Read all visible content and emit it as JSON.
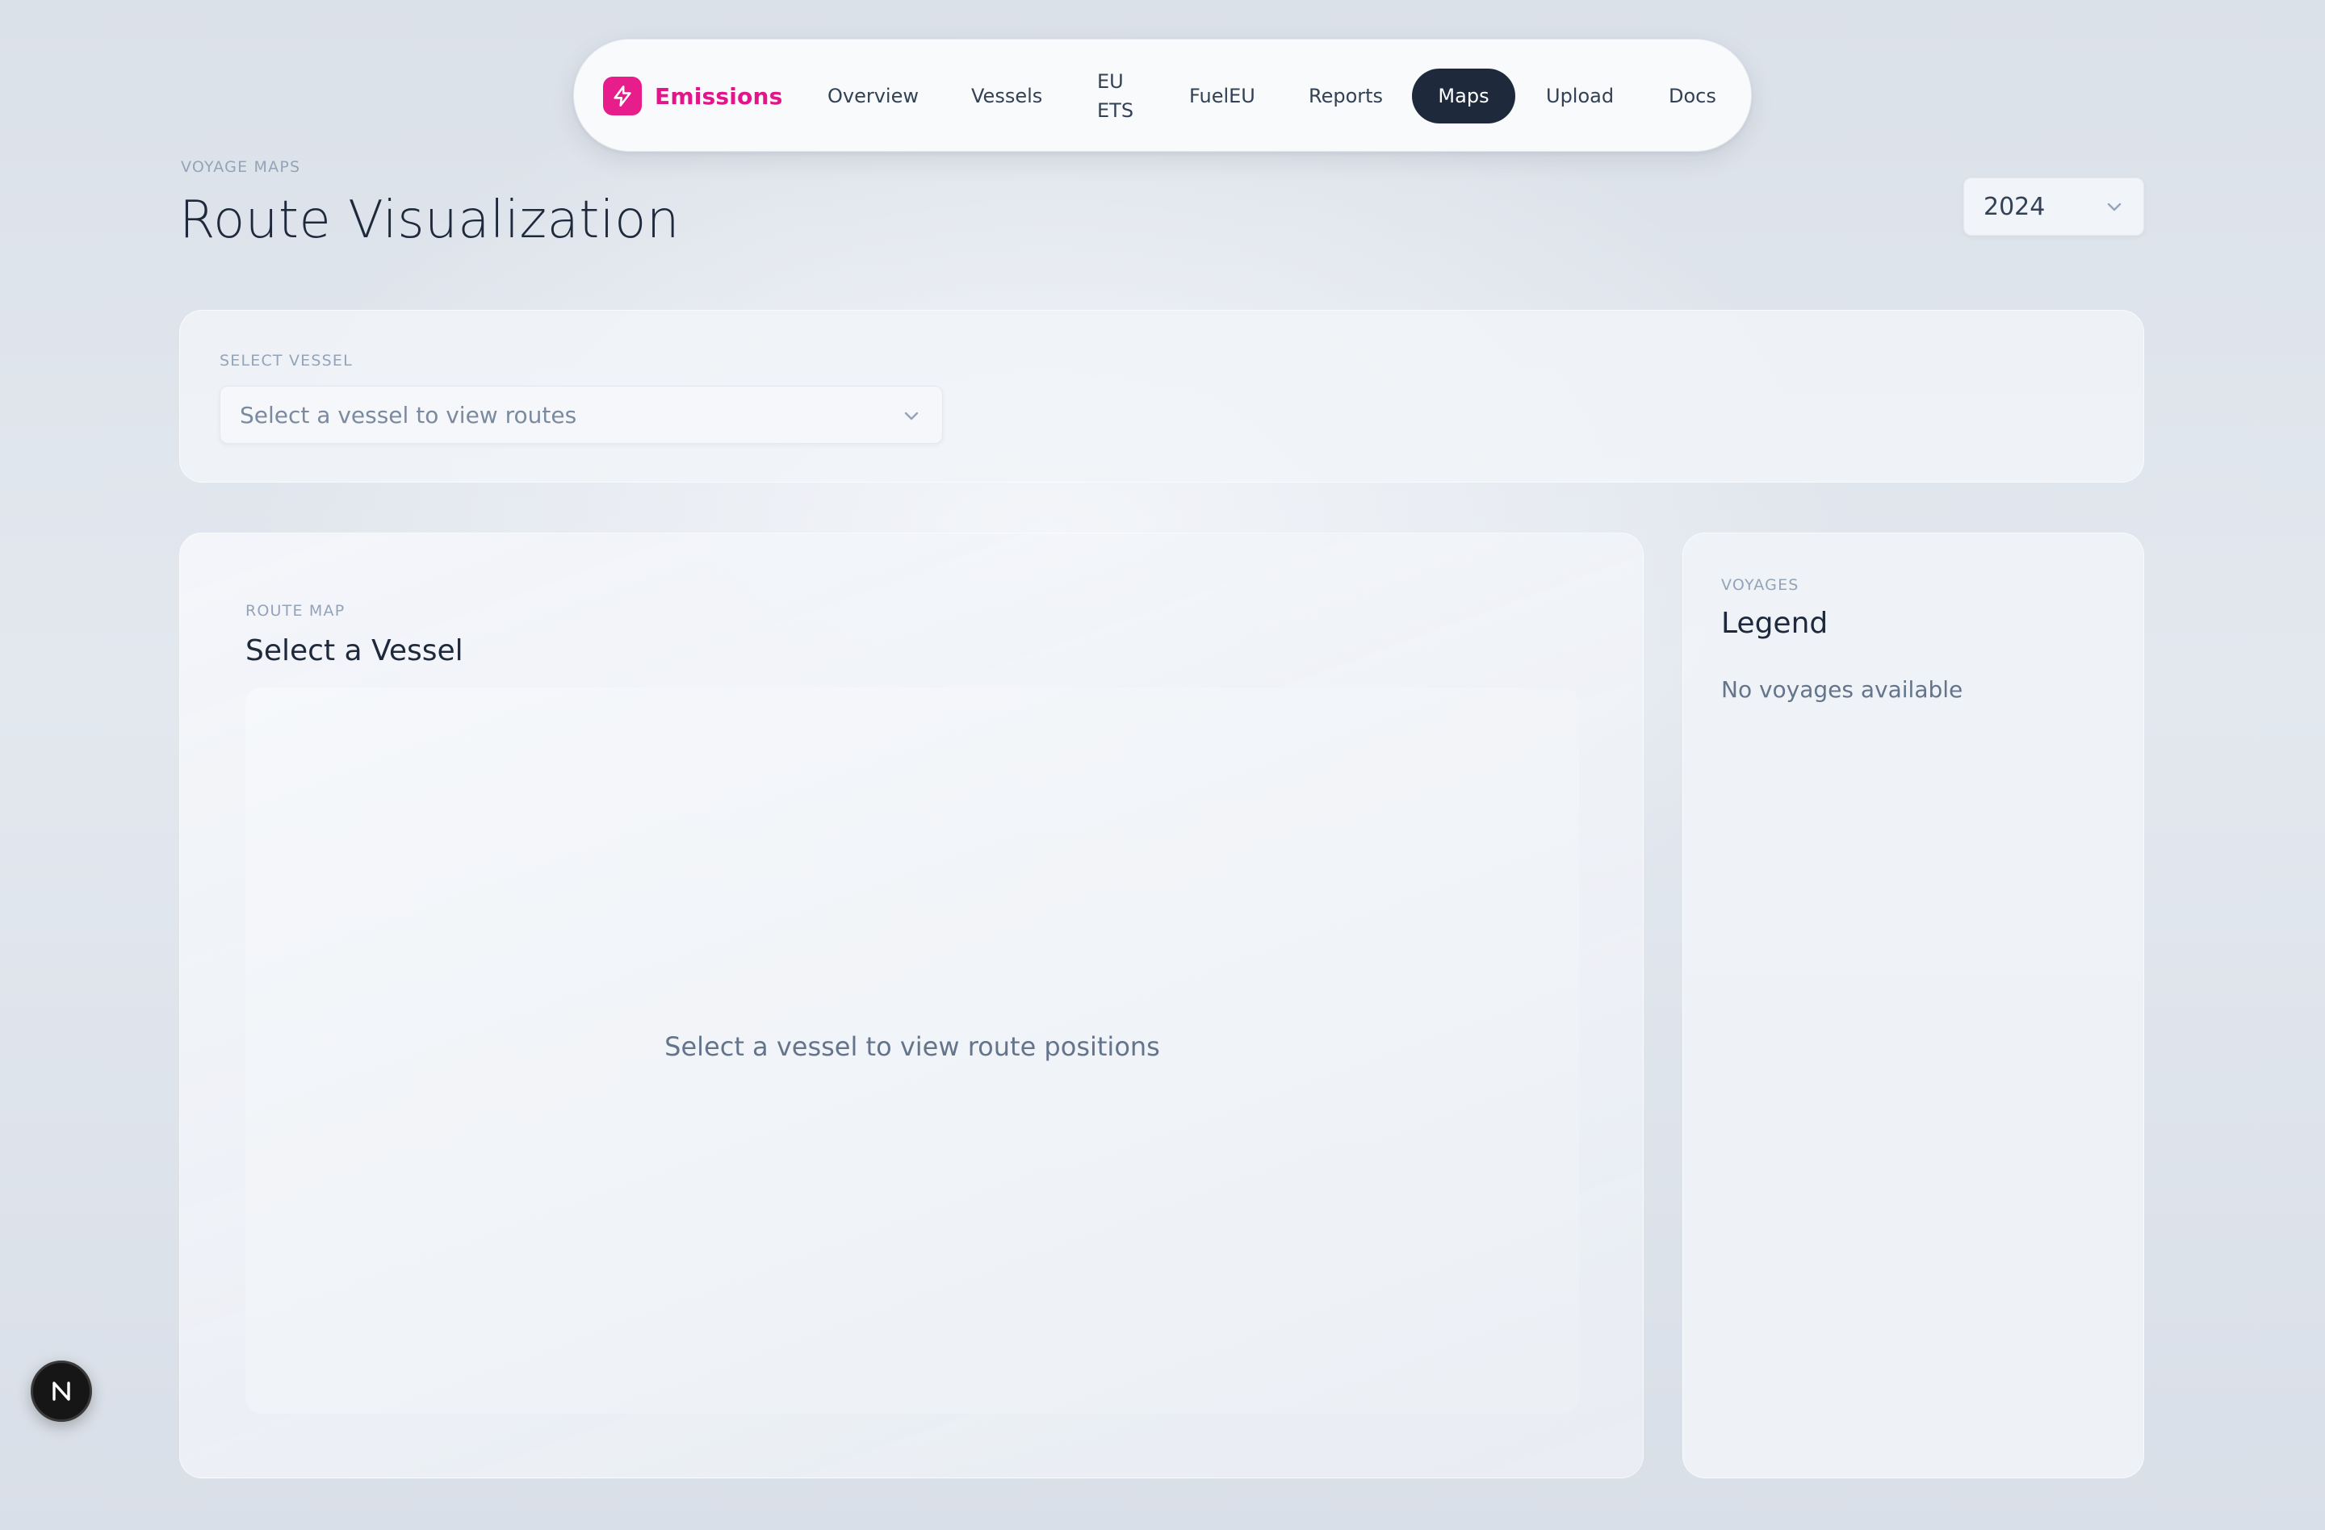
{
  "nav": {
    "brand": "Emissions",
    "brand_icon": "lightning-bolt-icon",
    "brand_color": "#e81d8c",
    "items": [
      {
        "label": "Overview"
      },
      {
        "label": "Vessels"
      },
      {
        "label_line1": "EU",
        "label_line2": "ETS"
      },
      {
        "label": "FuelEU"
      },
      {
        "label": "Reports"
      },
      {
        "label": "Maps",
        "active": true
      },
      {
        "label": "Upload"
      },
      {
        "label": "Docs"
      }
    ],
    "active_color": "#1e293b"
  },
  "header": {
    "eyebrow": "VOYAGE MAPS",
    "title": "Route Visualization",
    "year_select": {
      "value": "2024",
      "icon": "chevron-down-icon"
    }
  },
  "vessel_panel": {
    "label": "SELECT VESSEL",
    "placeholder": "Select a vessel to view routes",
    "icon": "chevron-down-icon"
  },
  "map_panel": {
    "eyebrow": "ROUTE MAP",
    "title": "Select a Vessel",
    "empty_message": "Select a vessel to view route positions"
  },
  "legend_panel": {
    "eyebrow": "VOYAGES",
    "title": "Legend",
    "empty_message": "No voyages available"
  },
  "floating_badge": {
    "letter": "N",
    "icon": "next-logo-icon"
  }
}
